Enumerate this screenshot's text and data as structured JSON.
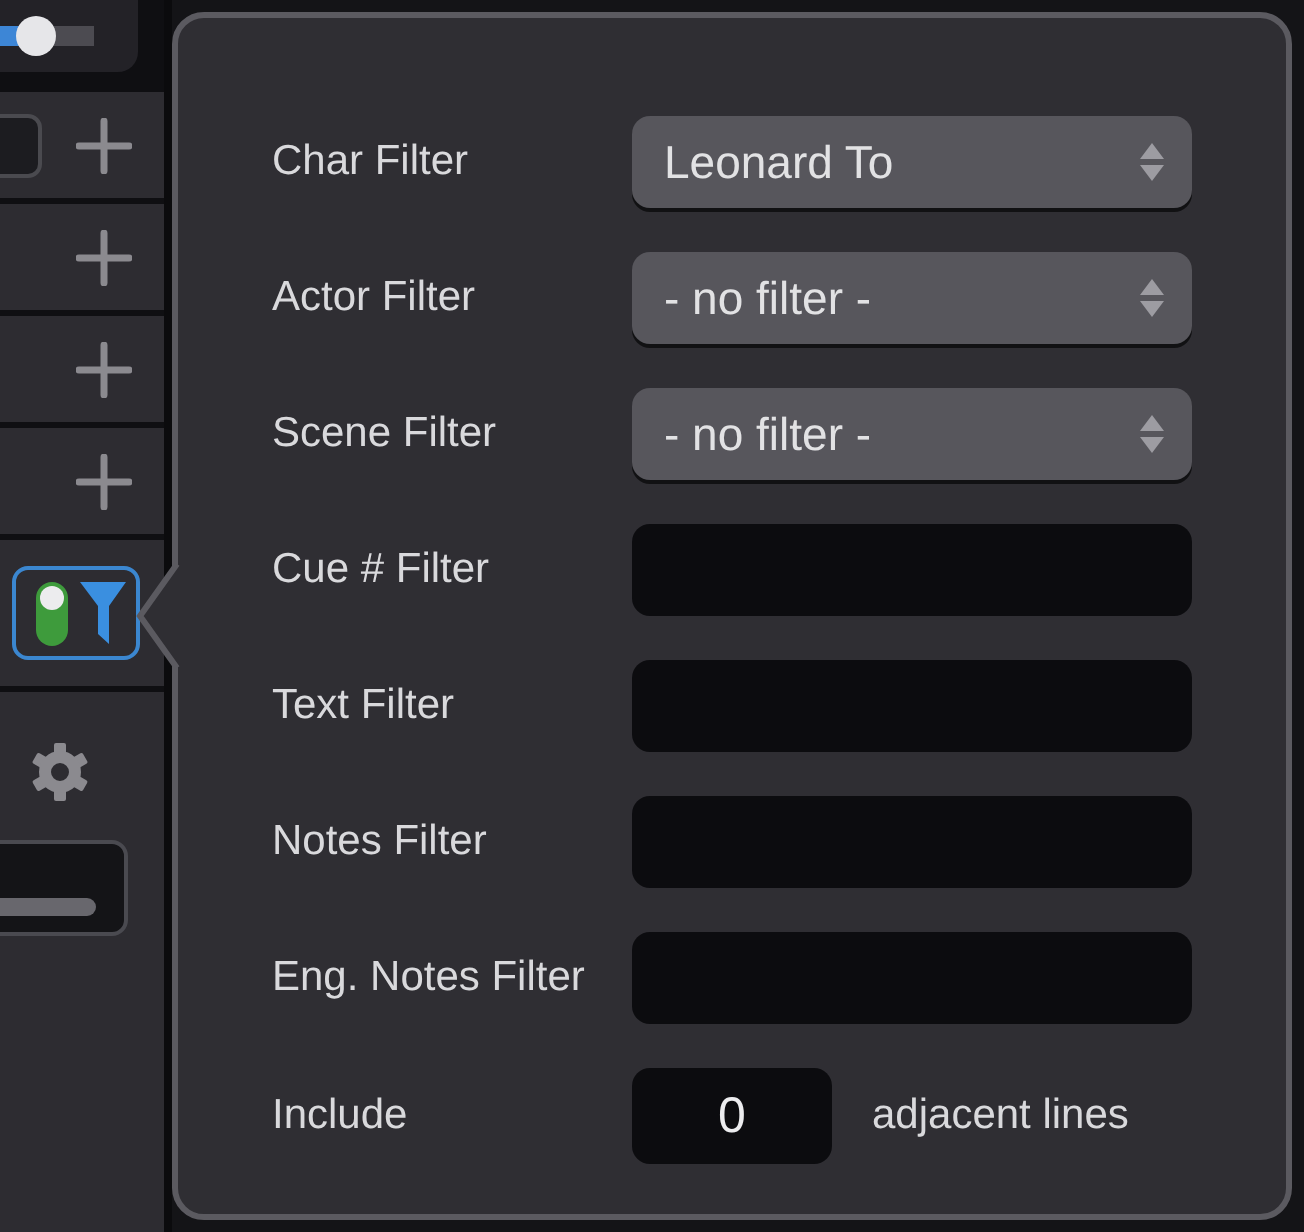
{
  "sidebar": {
    "slider": {
      "level": 0.38
    },
    "rows": [
      {
        "kind": "field"
      },
      {
        "kind": "plain"
      },
      {
        "kind": "plain"
      },
      {
        "kind": "plain"
      }
    ],
    "filter_toggle": {
      "on": true
    }
  },
  "filter_popover": {
    "filters": [
      {
        "label": "Char Filter",
        "kind": "select",
        "value": "Leonard To"
      },
      {
        "label": "Actor Filter",
        "kind": "select",
        "value": "- no filter -"
      },
      {
        "label": "Scene Filter",
        "kind": "select",
        "value": "- no filter -"
      },
      {
        "label": "Cue # Filter",
        "kind": "text"
      },
      {
        "label": "Text Filter",
        "kind": "text"
      },
      {
        "label": "Notes Filter",
        "kind": "text"
      },
      {
        "label": "Eng. Notes Filter",
        "kind": "text"
      }
    ],
    "include": {
      "label": "Include",
      "value": "0",
      "suffix": "adjacent lines"
    }
  }
}
